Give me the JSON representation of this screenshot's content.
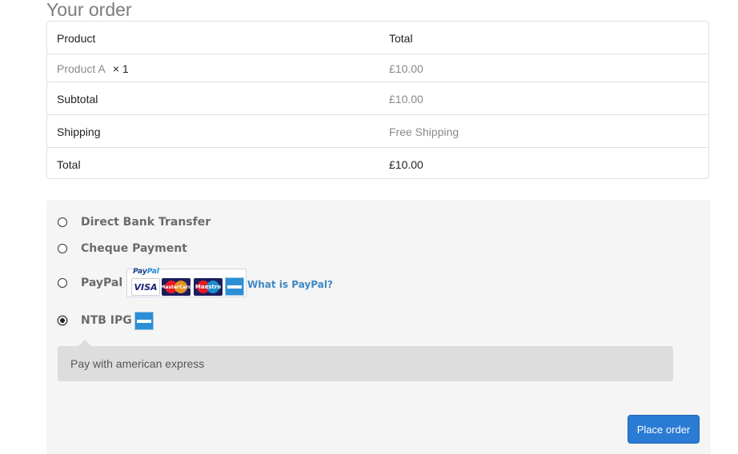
{
  "heading": "Your order",
  "table": {
    "header": {
      "product": "Product",
      "total": "Total"
    },
    "item": {
      "name": "Product A",
      "qty": "× 1",
      "total": "£10.00"
    },
    "subtotal": {
      "label": "Subtotal",
      "value": "£10.00"
    },
    "shipping": {
      "label": "Shipping",
      "value": "Free Shipping"
    },
    "total": {
      "label": "Total",
      "value": "£10.00"
    }
  },
  "payment": {
    "methods": [
      {
        "label": "Direct Bank Transfer",
        "selected": false
      },
      {
        "label": "Cheque Payment",
        "selected": false
      },
      {
        "label": "PayPal",
        "selected": false
      },
      {
        "label": "NTB IPG",
        "selected": true
      }
    ],
    "paypal_badge": {
      "logo": "PayPal",
      "cards": [
        "VISA",
        "MasterCard",
        "Maestro",
        "American Express"
      ]
    },
    "paypal_link": "What is PayPal?",
    "description": "Pay with american express",
    "place_order": "Place order"
  },
  "colors": {
    "accent": "#2a7bd3",
    "link": "#3e87c5",
    "panel": "#f5f5f5"
  }
}
